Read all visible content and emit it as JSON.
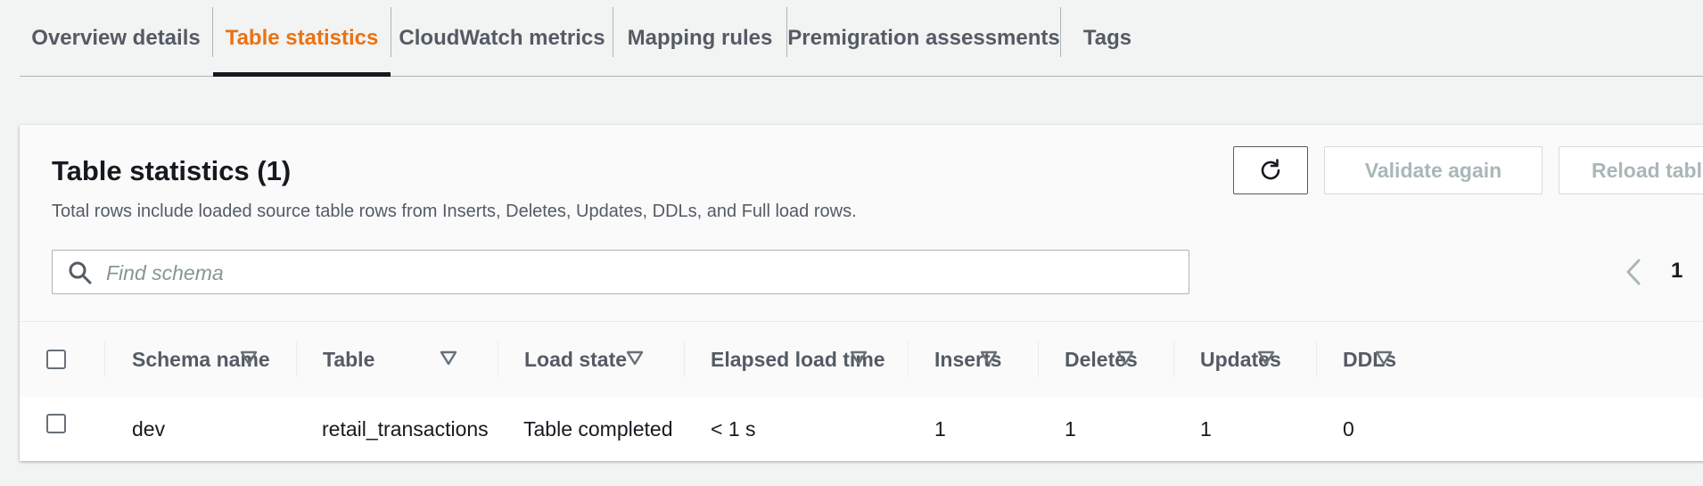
{
  "tabs": [
    {
      "label": "Overview details"
    },
    {
      "label": "Table statistics",
      "active": true
    },
    {
      "label": "CloudWatch metrics"
    },
    {
      "label": "Mapping rules"
    },
    {
      "label": "Premigration assessments"
    },
    {
      "label": "Tags"
    }
  ],
  "panel": {
    "title": "Table statistics (1)",
    "description": "Total rows include loaded source table rows from Inserts, Deletes, Updates, DDLs, and Full load rows.",
    "refresh_icon": "refresh-icon",
    "validate_label": "Validate again",
    "reload_label": "Reload table data",
    "search_placeholder": "Find schema",
    "search_value": "",
    "current_page": "1"
  },
  "table": {
    "columns": [
      "Schema name",
      "Table",
      "Load state",
      "Elapsed load time",
      "Inserts",
      "Deletes",
      "Updates",
      "DDLs"
    ],
    "rows": [
      {
        "schema": "dev",
        "table": "retail_transactions",
        "load_state": "Table completed",
        "elapsed": "< 1 s",
        "inserts": "1",
        "deletes": "1",
        "updates": "1",
        "ddls": "0"
      }
    ]
  },
  "colors": {
    "active_tab": "#ec7211",
    "text": "#16191f",
    "muted_text": "#545b64",
    "disabled": "#aab7b8",
    "background": "#f2f3f3"
  }
}
